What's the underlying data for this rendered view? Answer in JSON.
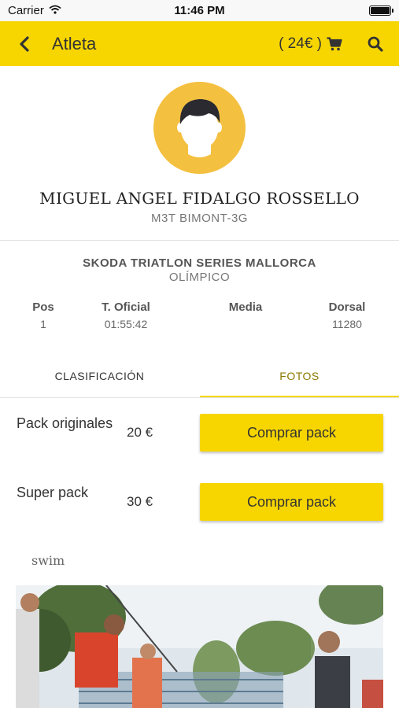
{
  "status_bar": {
    "carrier": "Carrier",
    "time": "11:46 PM"
  },
  "nav": {
    "title": "Atleta",
    "cart_label": "( 24€ )"
  },
  "athlete": {
    "name": "MIGUEL ANGEL FIDALGO ROSSELLO",
    "club": "M3T BIMONT-3G"
  },
  "event": {
    "name": "SKODA TRIATLON SERIES MALLORCA",
    "distance": "OLÍMPICO"
  },
  "stats": [
    {
      "header": "Pos",
      "value": "1"
    },
    {
      "header": "T. Oficial",
      "value": "01:55:42"
    },
    {
      "header": "Media",
      "value": ""
    },
    {
      "header": "Dorsal",
      "value": "11280"
    }
  ],
  "tabs": [
    {
      "label": "CLASIFICACIÓN",
      "active": false
    },
    {
      "label": "FOTOS",
      "active": true
    }
  ],
  "packs": [
    {
      "name": "Pack originales",
      "price": "20 €",
      "button": "Comprar pack"
    },
    {
      "name": "Super pack",
      "price": "30 €",
      "button": "Comprar pack"
    }
  ],
  "gallery": {
    "section_label": "swim"
  },
  "colors": {
    "accent": "#f7d600",
    "avatar_bg": "#f4c040",
    "active_tab_text": "#8a7a00"
  },
  "icons": {
    "back": "chevron-left-icon",
    "cart": "cart-icon",
    "search": "search-icon",
    "wifi": "wifi-icon",
    "battery": "battery-icon"
  }
}
